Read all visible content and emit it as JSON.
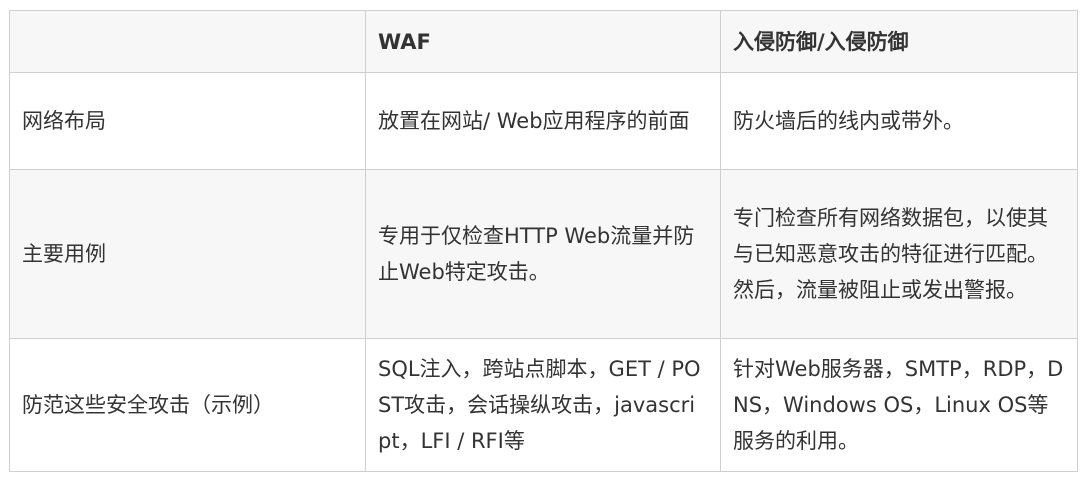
{
  "table": {
    "header": [
      "",
      "WAF",
      "入侵防御/入侵防御"
    ],
    "rows": [
      {
        "label": "网络布局",
        "waf": "放置在网站/ Web应用程序的前面",
        "ips": "防火墙后的线内或带外。"
      },
      {
        "label": "主要用例",
        "waf": "专用于仅检查HTTP Web流量并防止Web特定攻击。",
        "ips": "专门检查所有网络数据包，以使其与已知恶意攻击的特征进行匹配。然后，流量被阻止或发出警报。"
      },
      {
        "label": "防范这些安全攻击（示例）",
        "waf": "SQL注入，跨站点脚本，GET / POST攻击，会话操纵攻击，javascript，LFI / RFI等",
        "ips": "针对Web服务器，SMTP，RDP，DNS，Windows OS，Linux OS等服务的利用。"
      }
    ]
  }
}
